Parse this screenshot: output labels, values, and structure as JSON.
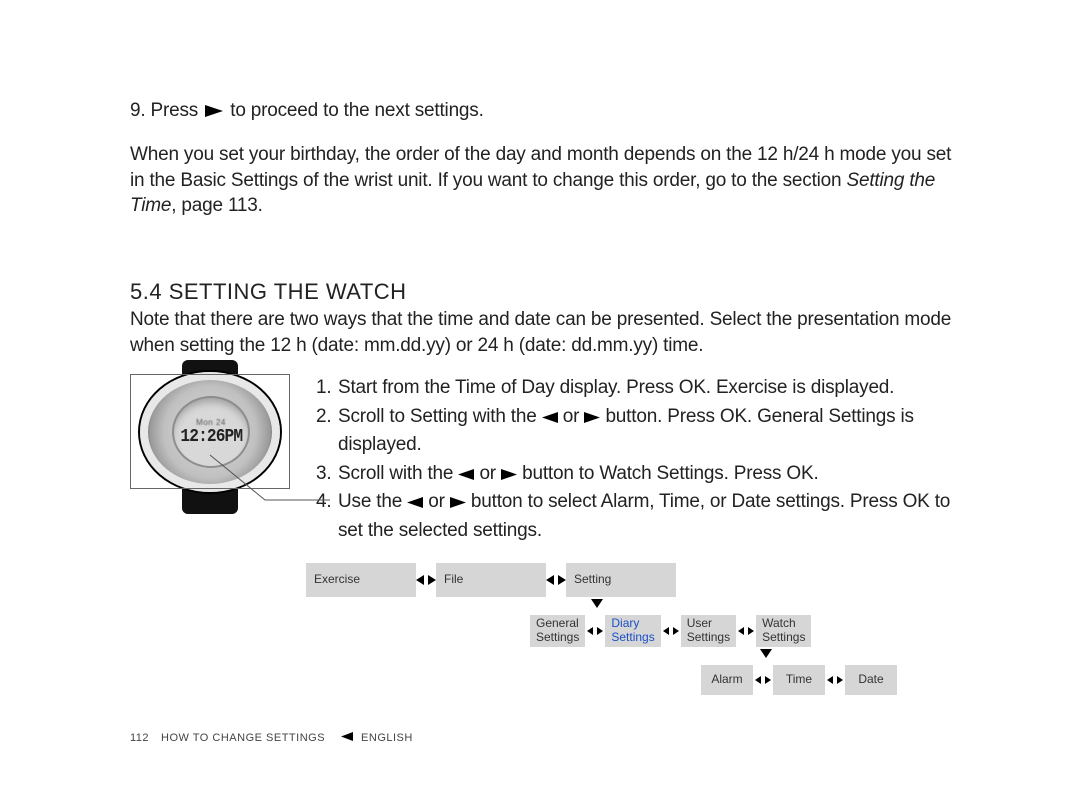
{
  "step9": {
    "prefix": "9.  Press ",
    "suffix": " to proceed to the next settings."
  },
  "intro": {
    "text_a": "When you set your birthday, the order of the day and month depends on the 12 h/24 h mode you set in the Basic Settings of the wrist unit. If you want to change this order, go to the section ",
    "ital": "Setting the Time",
    "text_b": ", page 113."
  },
  "heading": "5.4 SETTING THE WATCH",
  "note": "Note that there are two ways that the time and date can be presented. Select the presentation mode when setting the 12 h (date: mm.dd.yy) or 24 h (date: dd.mm.yy) time.",
  "watch": {
    "top_label": "Mon 24",
    "time": "12:26PM"
  },
  "steps": [
    {
      "n": "1.",
      "parts": [
        "Start from the Time of Day display. Press OK. Exercise is displayed."
      ]
    },
    {
      "n": "2.",
      "parts": [
        "Scroll to Setting with the ",
        " or ",
        " button. Press OK. General Settings is displayed."
      ]
    },
    {
      "n": "3.",
      "parts": [
        "Scroll with the ",
        " or ",
        " button to Watch Settings. Press OK."
      ]
    },
    {
      "n": "4.",
      "parts": [
        "Use the ",
        " or ",
        " button to select Alarm, Time, or Date settings. Press OK to set the selected settings."
      ]
    }
  ],
  "nav": {
    "row1": [
      "Exercise",
      "File",
      "Setting"
    ],
    "row2": [
      {
        "l1": "General",
        "l2": "Settings"
      },
      {
        "l1": "Diary",
        "l2": "Settings",
        "sel": true
      },
      {
        "l1": "User",
        "l2": "Settings"
      },
      {
        "l1": "Watch",
        "l2": "Settings"
      }
    ],
    "row3": [
      "Alarm",
      "Time",
      "Date"
    ]
  },
  "footer": {
    "page": "112",
    "section": "HOW TO CHANGE SETTINGS",
    "lang": "ENGLISH"
  }
}
